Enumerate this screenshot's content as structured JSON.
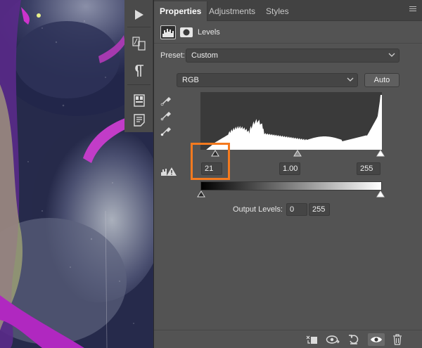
{
  "canvas": {
    "description_icons": [
      "artwork-canvas"
    ]
  },
  "toolstrip": {
    "icons": [
      "play-icon",
      "character-styles-icon",
      "paragraph-icon",
      "properties-panel-icon",
      "notes-icon"
    ]
  },
  "tabs": [
    {
      "label": "Properties",
      "active": true
    },
    {
      "label": "Adjustments",
      "active": false
    },
    {
      "label": "Styles",
      "active": false
    }
  ],
  "levels": {
    "title": "Levels",
    "preset_label": "Preset:",
    "preset_value": "Custom",
    "channel_value": "RGB",
    "auto_label": "Auto"
  },
  "input_levels": {
    "black": "21",
    "gamma": "1.00",
    "white": "255"
  },
  "output_levels": {
    "label": "Output Levels:",
    "black": "0",
    "white": "255"
  },
  "colors": {
    "highlight": "#f47a1f",
    "panel": "#535353",
    "tabbar": "#424242"
  },
  "bottom_bar": {
    "icons": [
      "clip-to-layer-icon",
      "view-previous-state-icon",
      "reset-icon",
      "visibility-icon",
      "trash-icon"
    ]
  }
}
